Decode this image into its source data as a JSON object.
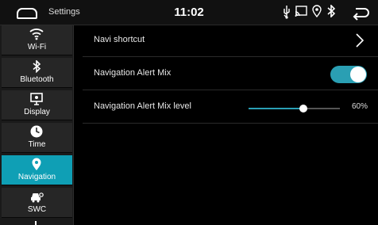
{
  "statusbar": {
    "app_title": "Settings",
    "clock": "11:02",
    "icons": [
      "usb-icon",
      "cast-icon",
      "location-icon",
      "bluetooth-icon"
    ]
  },
  "sidebar": {
    "items": [
      {
        "label": "Wi-Fi",
        "icon": "wifi-icon"
      },
      {
        "label": "Bluetooth",
        "icon": "bluetooth-icon"
      },
      {
        "label": "Display",
        "icon": "display-icon"
      },
      {
        "label": "Time",
        "icon": "clock-icon"
      },
      {
        "label": "Navigation",
        "icon": "location-pin-icon",
        "active": true
      },
      {
        "label": "SWC",
        "icon": "steering-wheel-control-icon"
      }
    ],
    "active_color": "#0f9fb5"
  },
  "main": {
    "navi_shortcut": {
      "label": "Navi shortcut"
    },
    "alert_mix": {
      "label": "Navigation Alert Mix",
      "enabled": true
    },
    "alert_mix_level": {
      "label": "Navigation Alert Mix level",
      "value": 0.6,
      "value_text": "60%"
    }
  },
  "colors": {
    "accent": "#2aa0b5"
  }
}
